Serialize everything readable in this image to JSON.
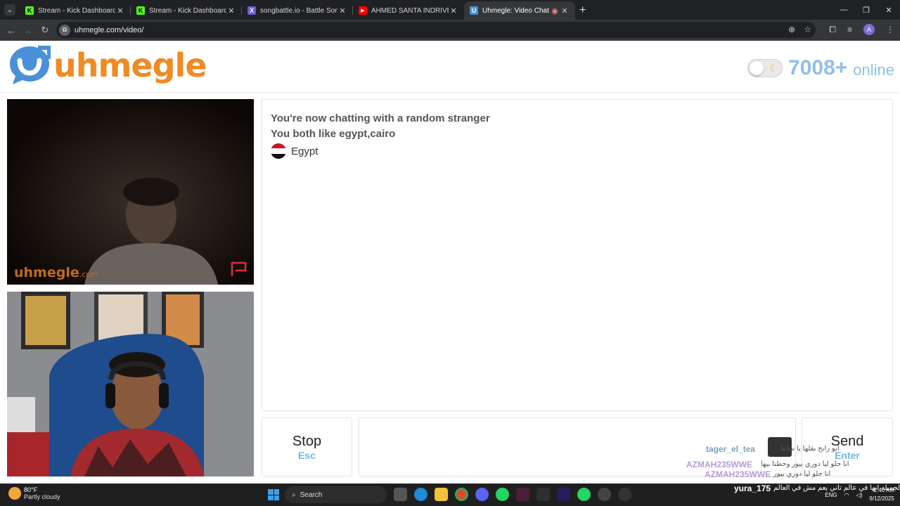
{
  "browser": {
    "tabs": [
      {
        "title": "Stream - Kick Dashboard",
        "favicon": "K",
        "favicon_color": "#53fc18",
        "active": false
      },
      {
        "title": "Stream - Kick Dashboard",
        "favicon": "K",
        "favicon_color": "#53fc18",
        "active": false
      },
      {
        "title": "songbattle.io - Battle Songs ag",
        "favicon": "X",
        "favicon_color": "#6b5cd6",
        "active": false
      },
      {
        "title": "AHMED SANTA INDRIVE - YouT",
        "favicon": "▶",
        "favicon_color": "#ff0000",
        "active": false
      },
      {
        "title": "Uhmegle: Video Chat | Ome",
        "favicon": "U",
        "favicon_color": "#4a90d9",
        "active": true
      }
    ],
    "url": "uhmegle.com/video/",
    "profile_initial": "A"
  },
  "header": {
    "logo_text": "uhmegle",
    "brand_orange": "#f08a24",
    "brand_blue": "#4a90d9",
    "online_count": "7008+",
    "online_label": "online"
  },
  "videos": {
    "watermark": "uhmegle",
    "watermark_suffix": ".com"
  },
  "chat": {
    "system_line1": "You're now chatting with a random stranger",
    "system_line2": "You both like egypt,cairo",
    "country": "Egypt"
  },
  "controls": {
    "stop_label": "Stop",
    "stop_key": "Esc",
    "send_label": "Send",
    "send_key": "Enter"
  },
  "overlay_chat": [
    {
      "user": "tager_el_tea",
      "text": "ابو رابح بقلها يا سانتا"
    },
    {
      "user": "AZMAH235WWE",
      "text": "انا حلو ليا دوري بيور وحطنا بيها"
    },
    {
      "user": "AZMAH235WWE",
      "text": "انا حلو ليا دوري بيور"
    },
    {
      "user": "yura_175",
      "text": "الجميله انها في عالم تاني يعم مش في العالم"
    }
  ],
  "taskbar": {
    "temp": "80°F",
    "weather": "Partly cloudy",
    "search": "Search",
    "lang": "ENG",
    "time": "1:40 AM",
    "date": "9/12/2025"
  }
}
